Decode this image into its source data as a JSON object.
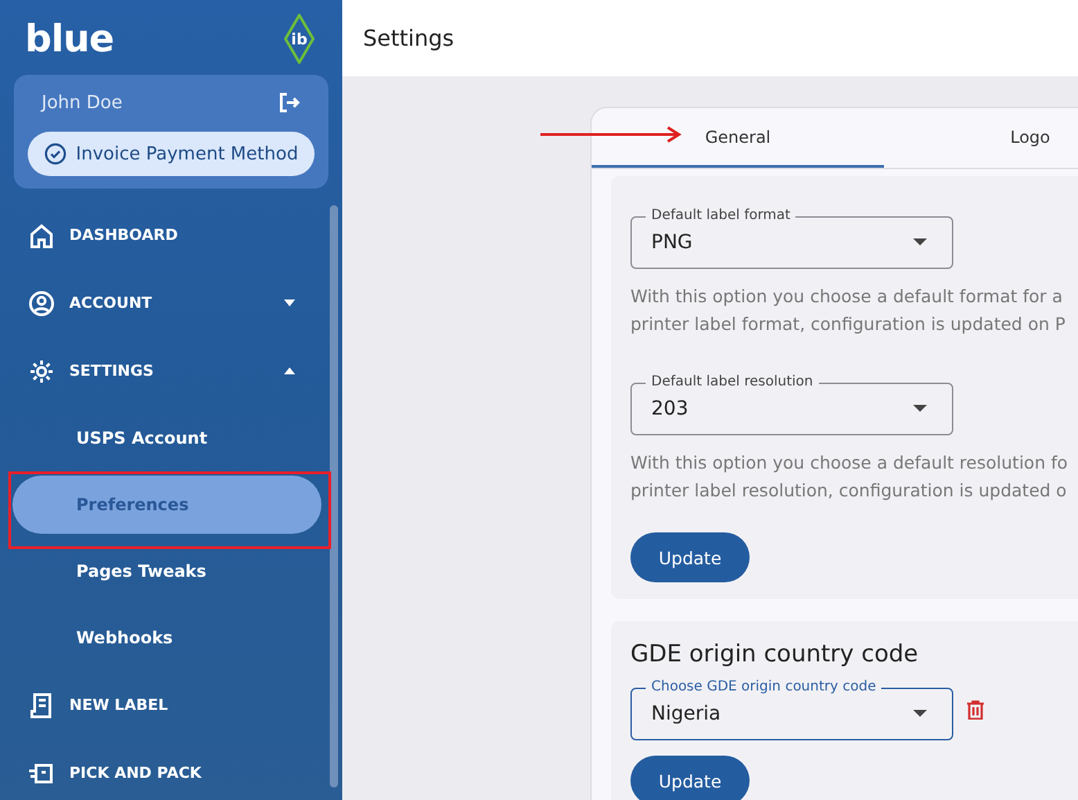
{
  "sidebar": {
    "logo": "blue",
    "badge": "ib",
    "user": {
      "name": "John Doe",
      "button": "Invoice Payment Method"
    },
    "nav": [
      {
        "label": "DASHBOARD"
      },
      {
        "label": "ACCOUNT",
        "expanded": false
      },
      {
        "label": "SETTINGS",
        "expanded": true,
        "children": [
          {
            "label": "USPS Account",
            "selected": false
          },
          {
            "label": "Preferences",
            "selected": true
          },
          {
            "label": "Pages Tweaks",
            "selected": false
          },
          {
            "label": "Webhooks",
            "selected": false
          }
        ]
      },
      {
        "label": "NEW LABEL"
      },
      {
        "label": "PICK AND PACK"
      }
    ]
  },
  "header": {
    "title": "Settings"
  },
  "tabs": [
    {
      "label": "General",
      "selected": true
    },
    {
      "label": "Logo",
      "selected": false
    }
  ],
  "label_section": {
    "fields": [
      {
        "label": "Default label format",
        "value": "PNG",
        "help": "With this option you choose a default format for a\nprinter label format, configuration is updated on P"
      },
      {
        "label": "Default label resolution",
        "value": "203",
        "help": "With this option you choose a default resolution fo\nprinter label resolution, configuration is updated o"
      }
    ],
    "button": "Update"
  },
  "gde_section": {
    "heading": "GDE origin country code",
    "field": {
      "label": "Choose GDE origin country code",
      "value": "Nigeria",
      "focused": true
    },
    "button": "Update"
  }
}
